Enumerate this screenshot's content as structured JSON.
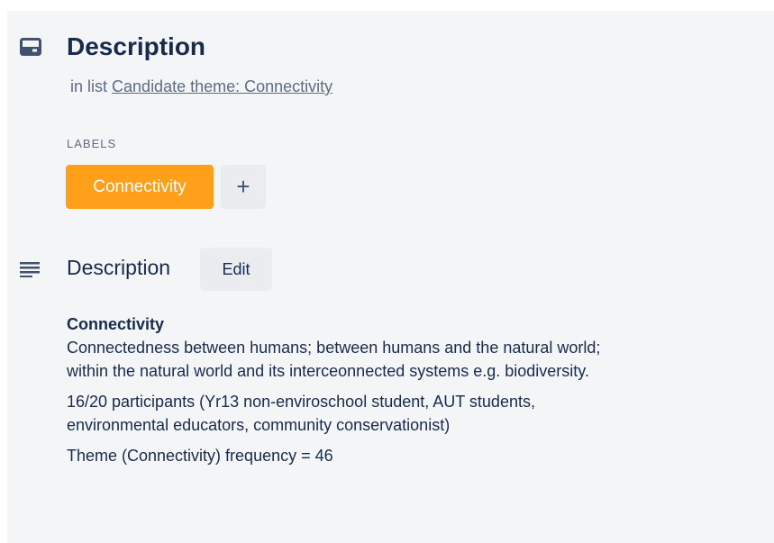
{
  "header": {
    "icon": "card-icon",
    "title": "Description",
    "in_list_prefix": "in list",
    "list_link": "Candidate theme: Connectivity"
  },
  "labels": {
    "heading": "LABELS",
    "items": [
      {
        "text": "Connectivity",
        "color": "#ff9f1a"
      }
    ],
    "add_symbol": "+"
  },
  "description": {
    "icon": "text-lines-icon",
    "title": "Description",
    "edit_label": "Edit",
    "heading": "Connectivity",
    "line1": "Connectedness between humans; between humans and the natural world;",
    "line2": "within the natural world and its interceonnected systems e.g. biodiversity.",
    "participants_line1": "16/20 participants (Yr13 non-enviroschool student, AUT students,",
    "participants_line2": "environmental educators, community conservationist)",
    "frequency": "Theme (Connectivity) frequency = 46"
  }
}
